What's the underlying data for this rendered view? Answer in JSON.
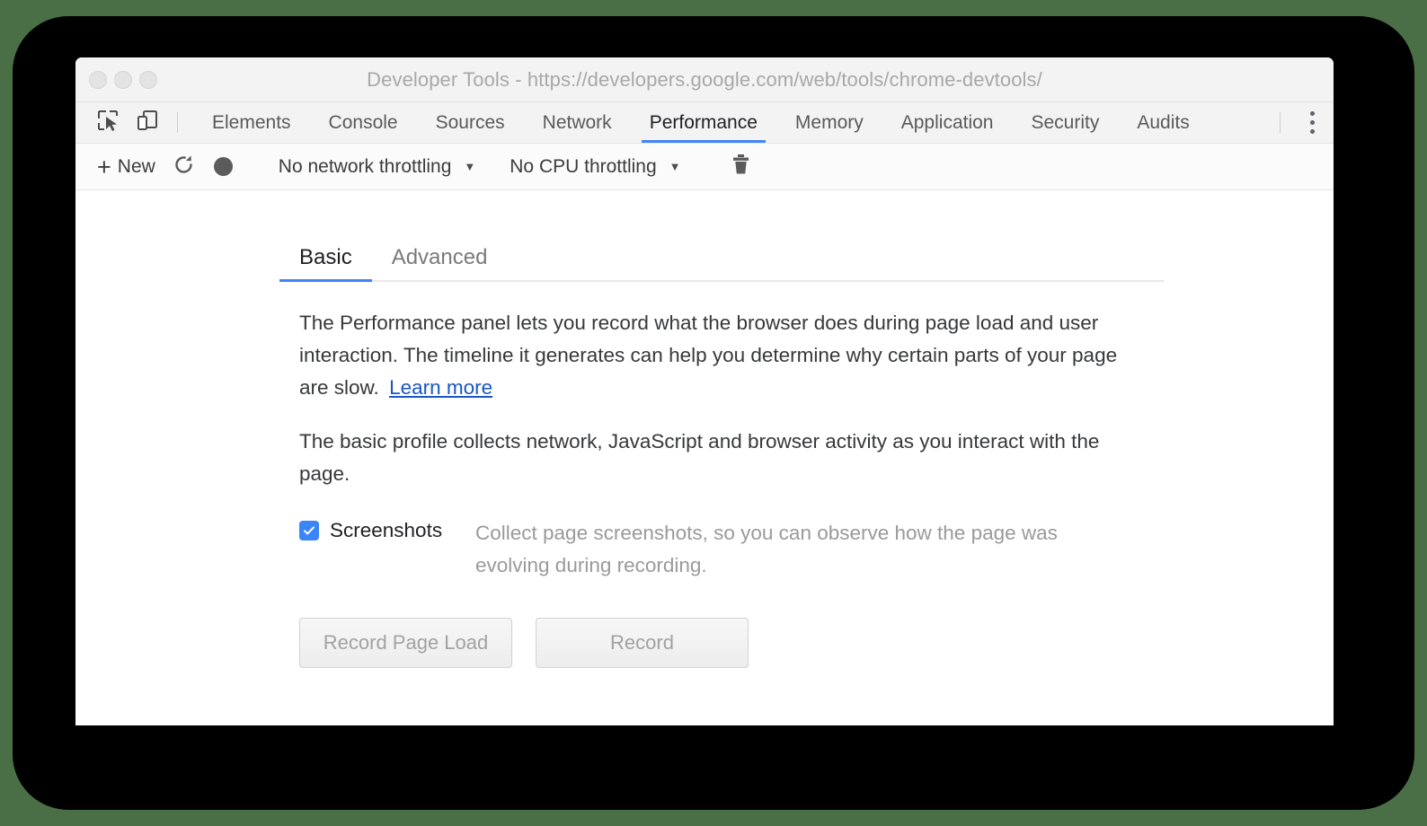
{
  "window": {
    "title": "Developer Tools - https://developers.google.com/web/tools/chrome-devtools/",
    "traffic_lights": [
      "close-button",
      "minimize-button",
      "maximize-button"
    ]
  },
  "tab_bar": {
    "left_icons": [
      {
        "name": "inspect-element-icon",
        "label": "Inspect element"
      },
      {
        "name": "device-toolbar-icon",
        "label": "Toggle device toolbar"
      }
    ],
    "tabs": [
      {
        "label": "Elements",
        "active": false
      },
      {
        "label": "Console",
        "active": false
      },
      {
        "label": "Sources",
        "active": false
      },
      {
        "label": "Network",
        "active": false
      },
      {
        "label": "Performance",
        "active": true
      },
      {
        "label": "Memory",
        "active": false
      },
      {
        "label": "Application",
        "active": false
      },
      {
        "label": "Security",
        "active": false
      },
      {
        "label": "Audits",
        "active": false
      }
    ],
    "overflow_menu_icon": "more-vertical-icon",
    "active_tab_accent": "#4285f4"
  },
  "toolbar": {
    "new_label": "New",
    "new_plus_glyph": "+",
    "reload_icon": "reload-icon",
    "record_icon": "record-circle-icon",
    "network_throttling": {
      "value": "No network throttling",
      "caret_glyph": "▼"
    },
    "cpu_throttling": {
      "value": "No CPU throttling",
      "caret_glyph": "▼"
    },
    "clear_icon": "trash-icon"
  },
  "panel": {
    "view_tabs": [
      {
        "label": "Basic",
        "active": true
      },
      {
        "label": "Advanced",
        "active": false
      }
    ],
    "paragraph_1": "The Performance panel lets you record what the browser does during page load and user interaction. The timeline it generates can help you determine why certain parts of your page are slow.",
    "learn_more_label": "Learn more",
    "paragraph_2": "The basic profile collects network, JavaScript and browser activity as you interact with the page.",
    "screenshots": {
      "checked": true,
      "checkmark_glyph": "✓",
      "label": "Screenshots",
      "description": "Collect page screenshots, so you can observe how the page was evolving during recording.",
      "checkbox_color": "#3b86f7"
    },
    "buttons": [
      {
        "label": "Record Page Load",
        "name": "record-page-load-button"
      },
      {
        "label": "Record",
        "name": "record-button"
      }
    ]
  },
  "colors": {
    "accent_blue": "#4285f4",
    "link_blue": "#1a56c4",
    "outer_background": "#4a6e45",
    "frame": "#000000",
    "chrome_grey": "#f3f3f3"
  }
}
